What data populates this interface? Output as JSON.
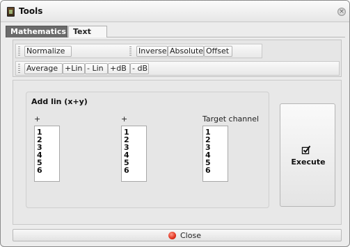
{
  "window": {
    "title": "Tools",
    "close_glyph": "×"
  },
  "tabs": [
    {
      "label": "Mathematics",
      "active": true
    },
    {
      "label": "Text",
      "active": false
    }
  ],
  "toolbar": {
    "row1_left": [
      "Normalize"
    ],
    "row1_right": [
      "Inverse",
      "Absolute",
      "Offset"
    ],
    "row2": [
      "Average",
      "+Lin",
      "- Lin",
      "+dB",
      "- dB"
    ]
  },
  "panel": {
    "group_title": "Add lin (x+y)",
    "columns": [
      {
        "label": "+",
        "items": [
          "1",
          "2",
          "3",
          "4",
          "5",
          "6"
        ]
      },
      {
        "label": "+",
        "items": [
          "1",
          "2",
          "3",
          "4",
          "5",
          "6"
        ]
      },
      {
        "label": "Target channel",
        "items": [
          "1",
          "2",
          "3",
          "4",
          "5",
          "6"
        ]
      }
    ],
    "execute_label": "Execute",
    "execute_icon": "checkbox-icon"
  },
  "footer": {
    "close_label": "Close",
    "close_icon": "red-circle-icon"
  },
  "colors": {
    "active_tab_bg": "#6b6b6b",
    "close_icon": "#e0301c"
  }
}
